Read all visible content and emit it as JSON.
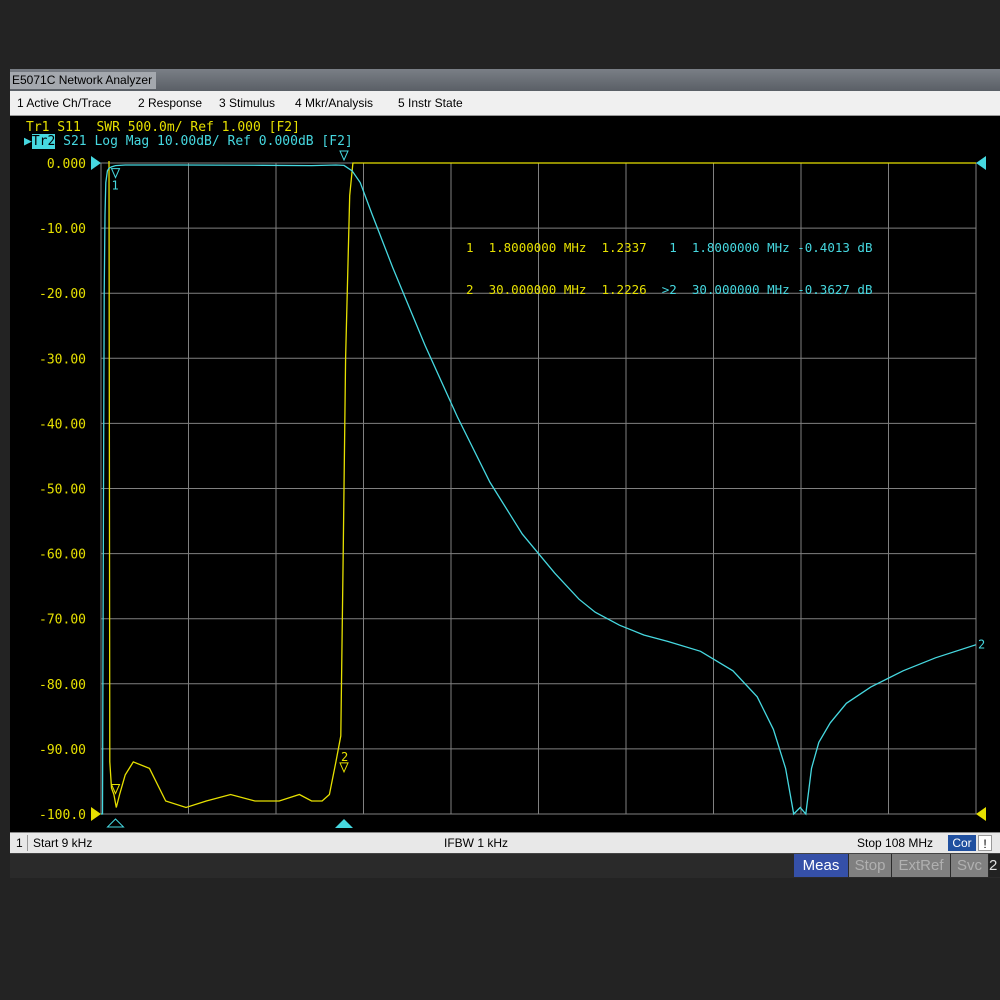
{
  "window": {
    "title": "E5071C Network Analyzer"
  },
  "menu": [
    "1 Active Ch/Trace",
    "2 Response",
    "3 Stimulus",
    "4 Mkr/Analysis",
    "5 Instr State"
  ],
  "traces": {
    "tr1": {
      "label": "Tr1",
      "text": " S11  SWR 500.0m/ Ref 1.000 [F2]",
      "color": "#e6e000"
    },
    "tr2": {
      "label": "Tr2",
      "text": " S21 Log Mag 10.00dB/ Ref 0.000dB [F2]",
      "color": "#46d8e0"
    }
  },
  "y_axis_labels": [
    "0.000",
    "-10.00",
    "-20.00",
    "-30.00",
    "-40.00",
    "-50.00",
    "-60.00",
    "-70.00",
    "-80.00",
    "-90.00",
    "-100.0"
  ],
  "markers": [
    {
      "num": "1",
      "freq": "1.8000000 MHz",
      "swr": "1.2337",
      "num2": " 1",
      "freq2": "1.8000000 MHz",
      "db": "-0.4013 dB"
    },
    {
      "num": "2",
      "freq": "30.000000 MHz",
      "swr": "1.2226",
      "num2": ">2",
      "freq2": "30.000000 MHz",
      "db": "-0.3627 dB"
    }
  ],
  "marker_flags": {
    "m1": "1",
    "m2": "2",
    "right_end": "2"
  },
  "status": {
    "channel": "1",
    "start": "Start 9 kHz",
    "ifbw": "IFBW 1 kHz",
    "stop": "Stop 108 MHz",
    "cor": "Cor",
    "bang": "!"
  },
  "softkeys": [
    "Meas",
    "Stop",
    "ExtRef",
    "Svc",
    "2"
  ],
  "colors": {
    "s11": "#e6e000",
    "s21": "#46d8e0",
    "grid": "#808080",
    "background": "#000000"
  },
  "chart_data": {
    "type": "line",
    "x_start": "9 kHz",
    "x_stop": "108 MHz",
    "ylim": [
      -100,
      0
    ],
    "y_div": 10,
    "grid": true,
    "x_divisions": 10,
    "series": [
      {
        "name": "S11",
        "unit_per_div": "500.0m",
        "ref": "1.000",
        "x_mhz": [
          0.009,
          0.35,
          0.7,
          0.9,
          1.0,
          1.1,
          1.3,
          1.6,
          1.9,
          2.3,
          3.0,
          4.0,
          6.0,
          8.0,
          10.5,
          13.0,
          16.0,
          19.0,
          22.0,
          24.5,
          26.0,
          27.3,
          28.2,
          29.0,
          29.6,
          29.9,
          30.2,
          30.7,
          31.1,
          31.4,
          31.7,
          32.2,
          108
        ],
        "y": [
          1.0,
          1.0,
          1.0,
          1.0,
          0.5,
          -92,
          -96,
          -97,
          -99,
          -97,
          -94,
          -92,
          -93,
          -98,
          -99,
          -98,
          -97,
          -98,
          -98,
          -97,
          -98,
          -98,
          -97,
          -92,
          -88,
          -60,
          -30,
          -5,
          0,
          0,
          0,
          0,
          0
        ]
      },
      {
        "name": "S21",
        "unit_per_div": "10.00dB",
        "ref": "0.000dB",
        "x_mhz": [
          0.009,
          0.2,
          0.3,
          0.4,
          0.5,
          0.6,
          0.8,
          1.0,
          1.3,
          1.8,
          3.0,
          10.0,
          20.0,
          26.0,
          29.0,
          30.0,
          31.0,
          32.0,
          33.5,
          36.0,
          40.0,
          44.0,
          48.0,
          52.0,
          56.0,
          59.0,
          61.0,
          64.0,
          67.0,
          70.0,
          74.0,
          78.0,
          81.0,
          83.0,
          84.5,
          85.5,
          86.3,
          87.0,
          87.7,
          88.6,
          90.0,
          92.0,
          95.0,
          99.0,
          103.0,
          108.0
        ],
        "y": [
          -100,
          -100,
          -55,
          -20,
          -8,
          -3,
          -1.2,
          -0.8,
          -0.6,
          -0.4013,
          -0.3,
          -0.3,
          -0.35,
          -0.4,
          -0.3,
          -0.3627,
          -1.2,
          -3,
          -8,
          -16,
          -28,
          -39,
          -49,
          -57,
          -63,
          -67,
          -69,
          -71,
          -72.5,
          -73.5,
          -75,
          -78,
          -82,
          -87,
          -93,
          -100,
          -99,
          -100,
          -93,
          -89,
          -86,
          -83,
          -80.5,
          -78,
          -76,
          -74
        ]
      }
    ]
  }
}
